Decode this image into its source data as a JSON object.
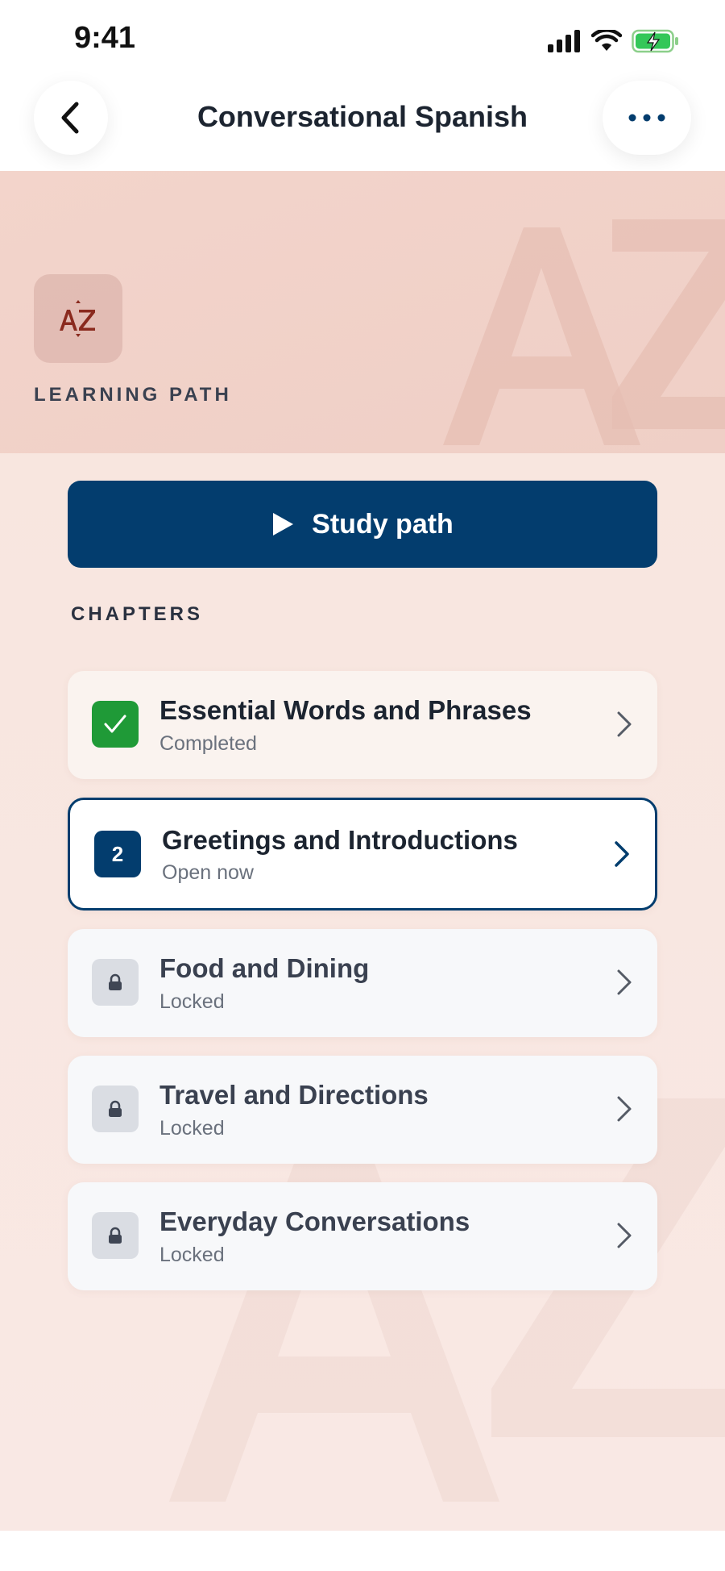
{
  "status_bar": {
    "time": "9:41"
  },
  "nav": {
    "title": "Conversational Spanish"
  },
  "hero": {
    "label": "LEARNING PATH",
    "icon_text": "AZ"
  },
  "study_button": {
    "label": "Study path"
  },
  "chapters": {
    "heading": "CHAPTERS",
    "items": [
      {
        "title": "Essential Words and Phrases",
        "status": "Completed",
        "state": "completed",
        "badge": "checkmark-icon"
      },
      {
        "title": "Greetings and Introductions",
        "status": "Open now",
        "state": "active",
        "badge_number": "2"
      },
      {
        "title": "Food and Dining",
        "status": "Locked",
        "state": "locked",
        "badge": "lock-icon"
      },
      {
        "title": "Travel and Directions",
        "status": "Locked",
        "state": "locked",
        "badge": "lock-icon"
      },
      {
        "title": "Everyday Conversations",
        "status": "Locked",
        "state": "locked",
        "badge": "lock-icon"
      }
    ]
  },
  "colors": {
    "primary": "#033d6e",
    "success": "#1f9a37",
    "hero_background": "#f3d4cb",
    "content_background": "#f8e6df"
  }
}
